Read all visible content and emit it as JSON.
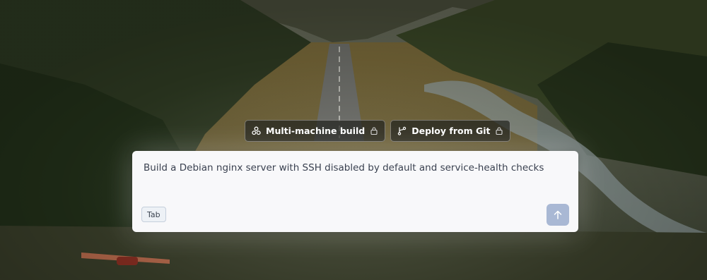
{
  "chips": [
    {
      "label": "Multi-machine build",
      "icon": "cluster-icon",
      "locked": true
    },
    {
      "label": "Deploy from Git",
      "icon": "git-branch-icon",
      "locked": true
    }
  ],
  "prompt": {
    "text": "Build a Debian nginx server with SSH disabled by default and service-health checks",
    "tab_hint": "Tab",
    "send_icon": "arrow-up-icon"
  },
  "colors": {
    "card_bg": "#f8f8fa",
    "send_bg": "#a9b8d4",
    "chip_bg": "#222420"
  }
}
